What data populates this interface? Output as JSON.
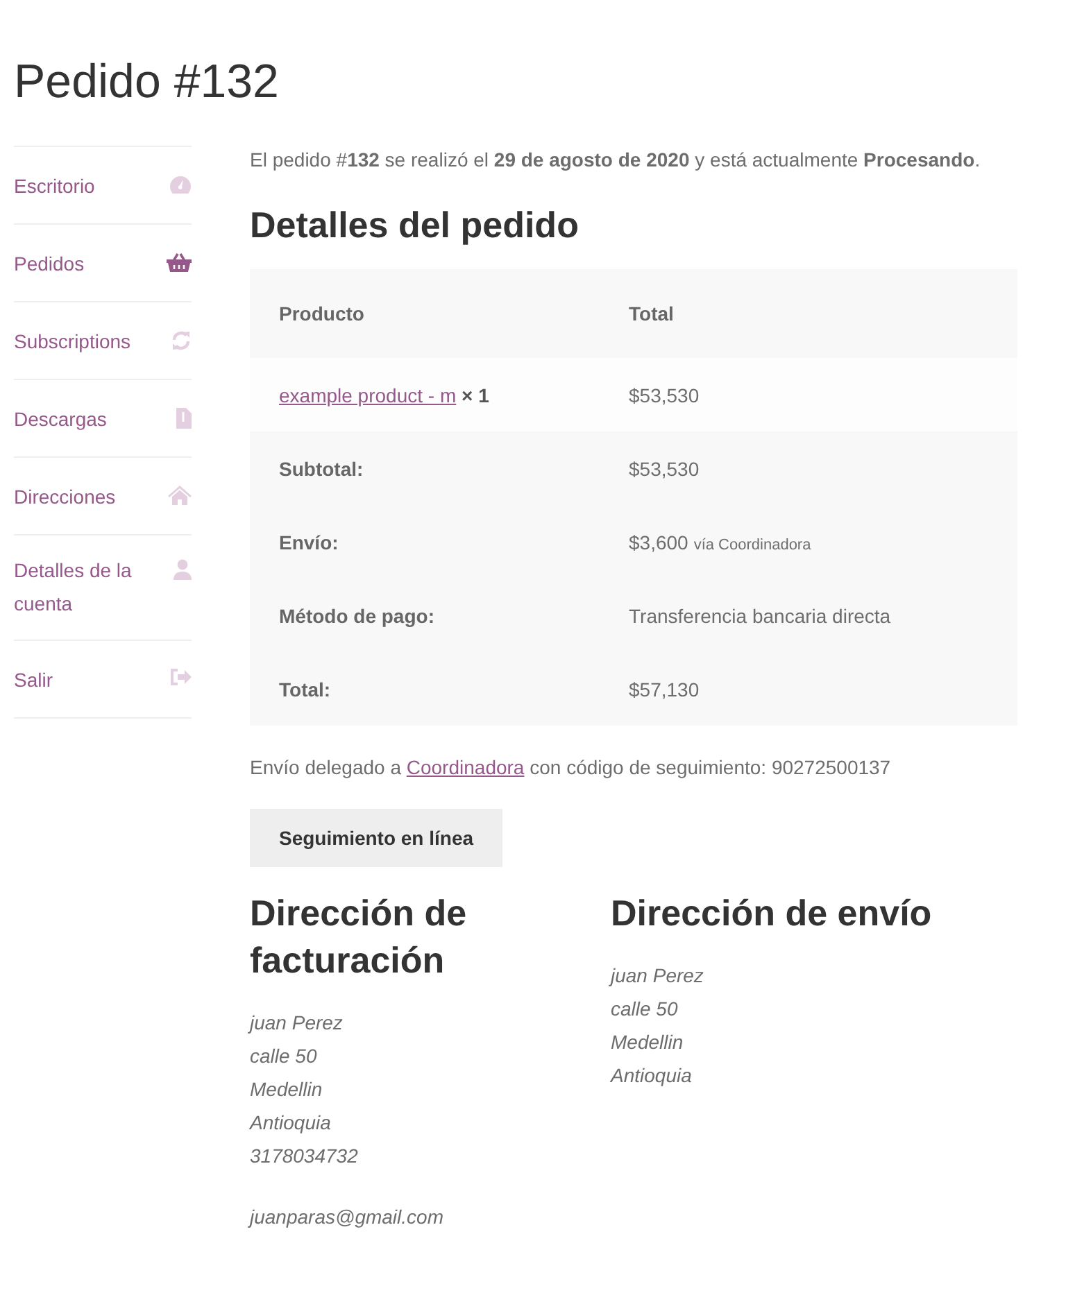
{
  "page_title": "Pedido #132",
  "sidebar": {
    "items": [
      {
        "label": "Escritorio",
        "kind": "gauge",
        "selected": false
      },
      {
        "label": "Pedidos",
        "kind": "basket",
        "selected": true
      },
      {
        "label": "Subscriptions",
        "kind": "refresh",
        "selected": false
      },
      {
        "label": "Descargas",
        "kind": "file",
        "selected": false
      },
      {
        "label": "Direcciones",
        "kind": "home",
        "selected": false
      },
      {
        "label": "Detalles de la cuenta",
        "kind": "user",
        "selected": false
      },
      {
        "label": "Salir",
        "kind": "logout",
        "selected": false
      }
    ]
  },
  "summary": "El pedido #**132** se realizó el **29 de agosto de 2020** y está actualmente **Procesando**.",
  "details": {
    "title": "Detalles del pedido",
    "columns": [
      "Producto",
      "Total"
    ],
    "items": [
      {
        "product": "example product - m",
        "quantity": "× 1",
        "total": "$53,530"
      }
    ],
    "totals": [
      {
        "label": "Subtotal:",
        "value": "$53,530"
      },
      {
        "label": "Envío:",
        "value": "$3,600",
        "note": "vía Coordinadora"
      },
      {
        "label": "Método de pago:",
        "value": "Transferencia bancaria directa"
      },
      {
        "label": "Total:",
        "value": "$57,130"
      }
    ]
  },
  "tracking": {
    "before": "Envío delegado a",
    "link": "Coordinadora",
    "after": "con código de seguimiento: 90272500137",
    "button": "Seguimiento en línea"
  },
  "addresses": [
    {
      "title": "Dirección de facturación",
      "lines": [
        "juan Perez",
        "calle 50",
        "Medellin",
        "Antioquia",
        "3178034732"
      ],
      "email": "juanparas@gmail.com"
    },
    {
      "title": "Dirección de envío",
      "lines": [
        "juan Perez",
        "calle 50",
        "Medellin",
        "Antioquia"
      ]
    }
  ]
}
